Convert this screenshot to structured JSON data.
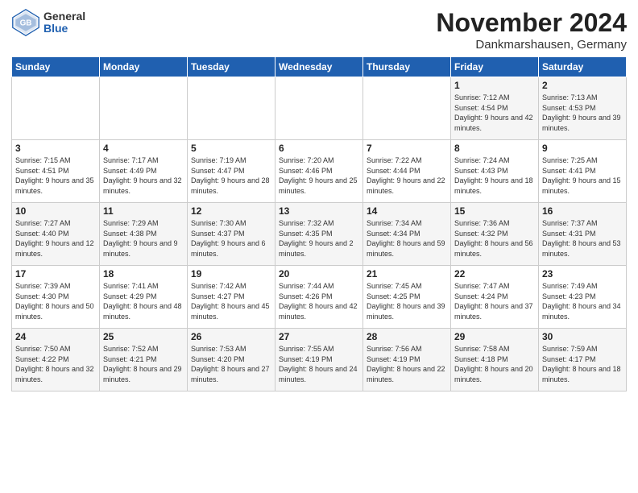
{
  "logo": {
    "general": "General",
    "blue": "Blue"
  },
  "title": "November 2024",
  "location": "Dankmarshausen, Germany",
  "days_of_week": [
    "Sunday",
    "Monday",
    "Tuesday",
    "Wednesday",
    "Thursday",
    "Friday",
    "Saturday"
  ],
  "weeks": [
    [
      {
        "day": "",
        "info": ""
      },
      {
        "day": "",
        "info": ""
      },
      {
        "day": "",
        "info": ""
      },
      {
        "day": "",
        "info": ""
      },
      {
        "day": "",
        "info": ""
      },
      {
        "day": "1",
        "info": "Sunrise: 7:12 AM\nSunset: 4:54 PM\nDaylight: 9 hours\nand 42 minutes."
      },
      {
        "day": "2",
        "info": "Sunrise: 7:13 AM\nSunset: 4:53 PM\nDaylight: 9 hours\nand 39 minutes."
      }
    ],
    [
      {
        "day": "3",
        "info": "Sunrise: 7:15 AM\nSunset: 4:51 PM\nDaylight: 9 hours\nand 35 minutes."
      },
      {
        "day": "4",
        "info": "Sunrise: 7:17 AM\nSunset: 4:49 PM\nDaylight: 9 hours\nand 32 minutes."
      },
      {
        "day": "5",
        "info": "Sunrise: 7:19 AM\nSunset: 4:47 PM\nDaylight: 9 hours\nand 28 minutes."
      },
      {
        "day": "6",
        "info": "Sunrise: 7:20 AM\nSunset: 4:46 PM\nDaylight: 9 hours\nand 25 minutes."
      },
      {
        "day": "7",
        "info": "Sunrise: 7:22 AM\nSunset: 4:44 PM\nDaylight: 9 hours\nand 22 minutes."
      },
      {
        "day": "8",
        "info": "Sunrise: 7:24 AM\nSunset: 4:43 PM\nDaylight: 9 hours\nand 18 minutes."
      },
      {
        "day": "9",
        "info": "Sunrise: 7:25 AM\nSunset: 4:41 PM\nDaylight: 9 hours\nand 15 minutes."
      }
    ],
    [
      {
        "day": "10",
        "info": "Sunrise: 7:27 AM\nSunset: 4:40 PM\nDaylight: 9 hours\nand 12 minutes."
      },
      {
        "day": "11",
        "info": "Sunrise: 7:29 AM\nSunset: 4:38 PM\nDaylight: 9 hours\nand 9 minutes."
      },
      {
        "day": "12",
        "info": "Sunrise: 7:30 AM\nSunset: 4:37 PM\nDaylight: 9 hours\nand 6 minutes."
      },
      {
        "day": "13",
        "info": "Sunrise: 7:32 AM\nSunset: 4:35 PM\nDaylight: 9 hours\nand 2 minutes."
      },
      {
        "day": "14",
        "info": "Sunrise: 7:34 AM\nSunset: 4:34 PM\nDaylight: 8 hours\nand 59 minutes."
      },
      {
        "day": "15",
        "info": "Sunrise: 7:36 AM\nSunset: 4:32 PM\nDaylight: 8 hours\nand 56 minutes."
      },
      {
        "day": "16",
        "info": "Sunrise: 7:37 AM\nSunset: 4:31 PM\nDaylight: 8 hours\nand 53 minutes."
      }
    ],
    [
      {
        "day": "17",
        "info": "Sunrise: 7:39 AM\nSunset: 4:30 PM\nDaylight: 8 hours\nand 50 minutes."
      },
      {
        "day": "18",
        "info": "Sunrise: 7:41 AM\nSunset: 4:29 PM\nDaylight: 8 hours\nand 48 minutes."
      },
      {
        "day": "19",
        "info": "Sunrise: 7:42 AM\nSunset: 4:27 PM\nDaylight: 8 hours\nand 45 minutes."
      },
      {
        "day": "20",
        "info": "Sunrise: 7:44 AM\nSunset: 4:26 PM\nDaylight: 8 hours\nand 42 minutes."
      },
      {
        "day": "21",
        "info": "Sunrise: 7:45 AM\nSunset: 4:25 PM\nDaylight: 8 hours\nand 39 minutes."
      },
      {
        "day": "22",
        "info": "Sunrise: 7:47 AM\nSunset: 4:24 PM\nDaylight: 8 hours\nand 37 minutes."
      },
      {
        "day": "23",
        "info": "Sunrise: 7:49 AM\nSunset: 4:23 PM\nDaylight: 8 hours\nand 34 minutes."
      }
    ],
    [
      {
        "day": "24",
        "info": "Sunrise: 7:50 AM\nSunset: 4:22 PM\nDaylight: 8 hours\nand 32 minutes."
      },
      {
        "day": "25",
        "info": "Sunrise: 7:52 AM\nSunset: 4:21 PM\nDaylight: 8 hours\nand 29 minutes."
      },
      {
        "day": "26",
        "info": "Sunrise: 7:53 AM\nSunset: 4:20 PM\nDaylight: 8 hours\nand 27 minutes."
      },
      {
        "day": "27",
        "info": "Sunrise: 7:55 AM\nSunset: 4:19 PM\nDaylight: 8 hours\nand 24 minutes."
      },
      {
        "day": "28",
        "info": "Sunrise: 7:56 AM\nSunset: 4:19 PM\nDaylight: 8 hours\nand 22 minutes."
      },
      {
        "day": "29",
        "info": "Sunrise: 7:58 AM\nSunset: 4:18 PM\nDaylight: 8 hours\nand 20 minutes."
      },
      {
        "day": "30",
        "info": "Sunrise: 7:59 AM\nSunset: 4:17 PM\nDaylight: 8 hours\nand 18 minutes."
      }
    ]
  ]
}
